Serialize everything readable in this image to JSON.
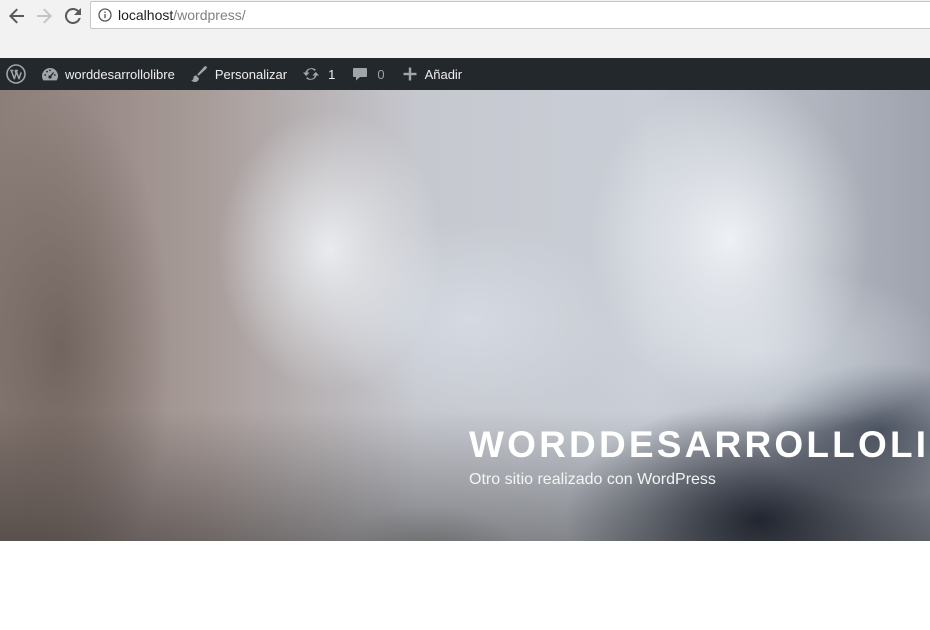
{
  "browser": {
    "url_host": "localhost",
    "url_path": "/wordpress/"
  },
  "admin_bar": {
    "wp_logo_icon": "wordpress-logo-icon",
    "site_icon": "dashboard-icon",
    "site_name": "worddesarrollolibre",
    "customize_icon": "paintbrush-icon",
    "customize_label": "Personalizar",
    "updates_icon": "updates-icon",
    "updates_count": "1",
    "comments_icon": "comment-icon",
    "comments_count": "0",
    "new_icon": "plus-icon",
    "new_label": "Añadir",
    "background_color": "#23282d"
  },
  "header": {
    "site_title": "WORDDESARROLLOLIBRE",
    "site_description": "Otro sitio realizado con WordPress"
  }
}
